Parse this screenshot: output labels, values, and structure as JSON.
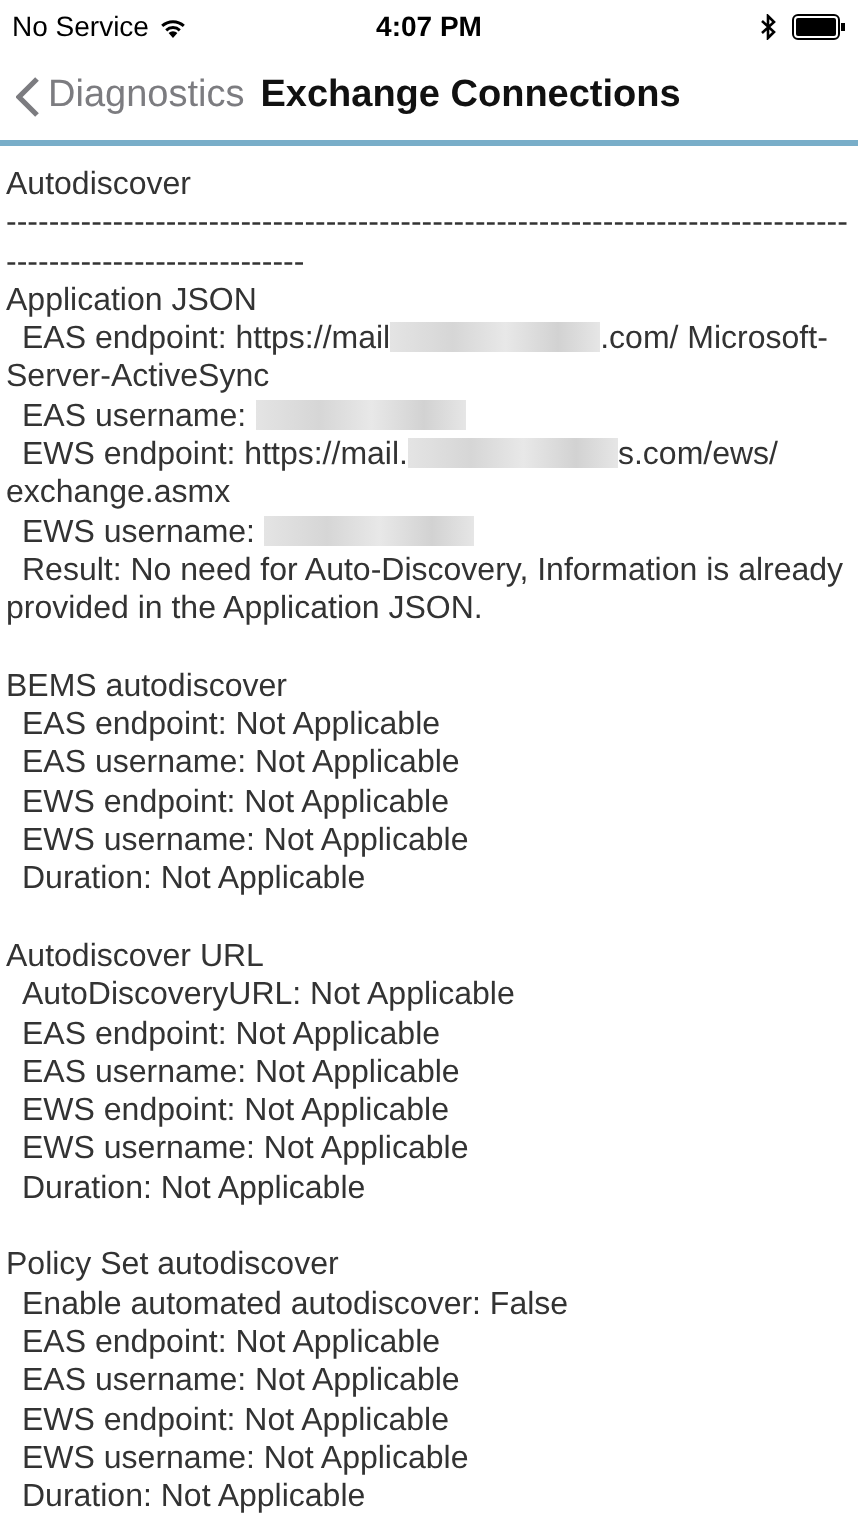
{
  "status_bar": {
    "carrier": "No Service",
    "time": "4:07 PM"
  },
  "nav": {
    "back_label": "Diagnostics",
    "title": "Exchange Connections"
  },
  "log": {
    "title": "Autodiscover",
    "separator": "-----------------------------------------------------------------------------------------------------------",
    "sections": [
      {
        "heading": "Application JSON",
        "lines": [
          {
            "text": "EAS endpoint: https://mail",
            "redacted": true,
            "after": ".com/ Microsoft-Server-ActiveSync"
          },
          {
            "text": "EAS username: ",
            "redacted": true
          },
          {
            "text": "EWS endpoint: https://mail.",
            "redacted": true,
            "after": "s.com/ews/ exchange.asmx"
          },
          {
            "text": "EWS username: ",
            "redacted": true
          },
          {
            "text": "Result: No need for Auto-Discovery, Information is already provided in the Application JSON."
          }
        ]
      },
      {
        "heading": "BEMS autodiscover",
        "lines": [
          {
            "text": "EAS endpoint: Not Applicable"
          },
          {
            "text": "EAS username: Not Applicable"
          },
          {
            "text": "EWS endpoint: Not Applicable"
          },
          {
            "text": "EWS username: Not Applicable"
          },
          {
            "text": "Duration: Not Applicable"
          }
        ]
      },
      {
        "heading": "Autodiscover URL",
        "lines": [
          {
            "text": "AutoDiscoveryURL: Not Applicable"
          },
          {
            "text": "EAS endpoint: Not Applicable"
          },
          {
            "text": "EAS username: Not Applicable"
          },
          {
            "text": "EWS endpoint: Not Applicable"
          },
          {
            "text": "EWS username: Not Applicable"
          },
          {
            "text": "Duration: Not Applicable"
          }
        ]
      },
      {
        "heading": "Policy Set autodiscover",
        "lines": [
          {
            "text": "Enable automated autodiscover: False"
          },
          {
            "text": "EAS endpoint: Not Applicable"
          },
          {
            "text": "EAS username: Not Applicable"
          },
          {
            "text": "EWS endpoint: Not Applicable"
          },
          {
            "text": "EWS username: Not Applicable"
          },
          {
            "text": "Duration: Not Applicable"
          }
        ]
      }
    ]
  }
}
